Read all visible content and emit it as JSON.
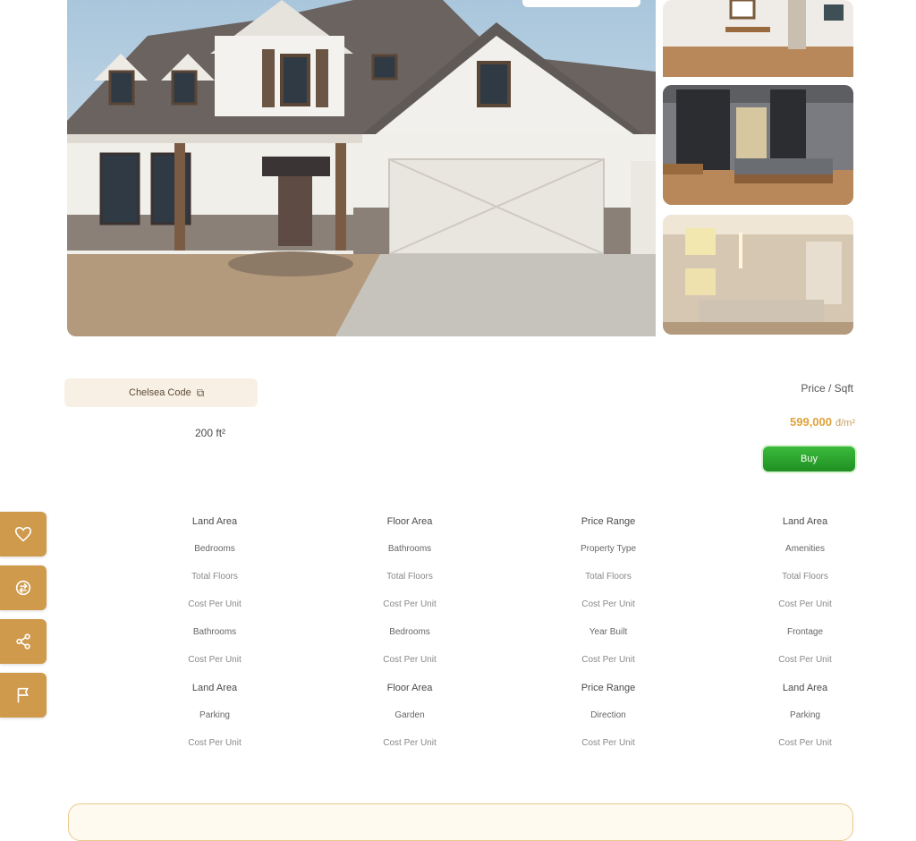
{
  "gallery": {
    "hero_alt": "",
    "thumbnails": [
      "living-room",
      "bedroom",
      "bathroom"
    ]
  },
  "info": {
    "code_label": "Chelsea Code",
    "copy_icon": "copy-icon",
    "area": "200 ft²",
    "price_label": "Price / Sqft",
    "price_value": "599,000",
    "price_currency": "đ/m²",
    "buy_label": "Buy"
  },
  "side_actions": [
    {
      "name": "favorite",
      "icon": "heart-icon"
    },
    {
      "name": "compare",
      "icon": "compare-icon"
    },
    {
      "name": "share",
      "icon": "share-icon"
    },
    {
      "name": "report",
      "icon": "flag-icon"
    }
  ],
  "specs": {
    "columns": [
      {
        "title": "Land Area",
        "rows": [
          "Bedrooms",
          "Total Floors",
          "Cost Per Unit",
          "Bathrooms",
          "Cost Per Unit",
          "Land Area",
          "Parking",
          "Cost Per Unit"
        ]
      },
      {
        "title": "Floor Area",
        "rows": [
          "Bathrooms",
          "Total Floors",
          "Cost Per Unit",
          "Bedrooms",
          "Cost Per Unit",
          "Floor Area",
          "Garden",
          "Cost Per Unit"
        ]
      },
      {
        "title": "Price Range",
        "rows": [
          "Property Type",
          "Total Floors",
          "Cost Per Unit",
          "Year Built",
          "Cost Per Unit",
          "Price Range",
          "Direction",
          "Cost Per Unit"
        ]
      },
      {
        "title": "Land Area",
        "rows": [
          "Amenities",
          "Total Floors",
          "Cost Per Unit",
          "Frontage",
          "Cost Per Unit",
          "Land Area",
          "Parking",
          "Cost Per Unit"
        ]
      }
    ]
  },
  "colors": {
    "accent": "#cf9a4c",
    "price": "#e0a23a",
    "buy": "#2ea52f"
  }
}
